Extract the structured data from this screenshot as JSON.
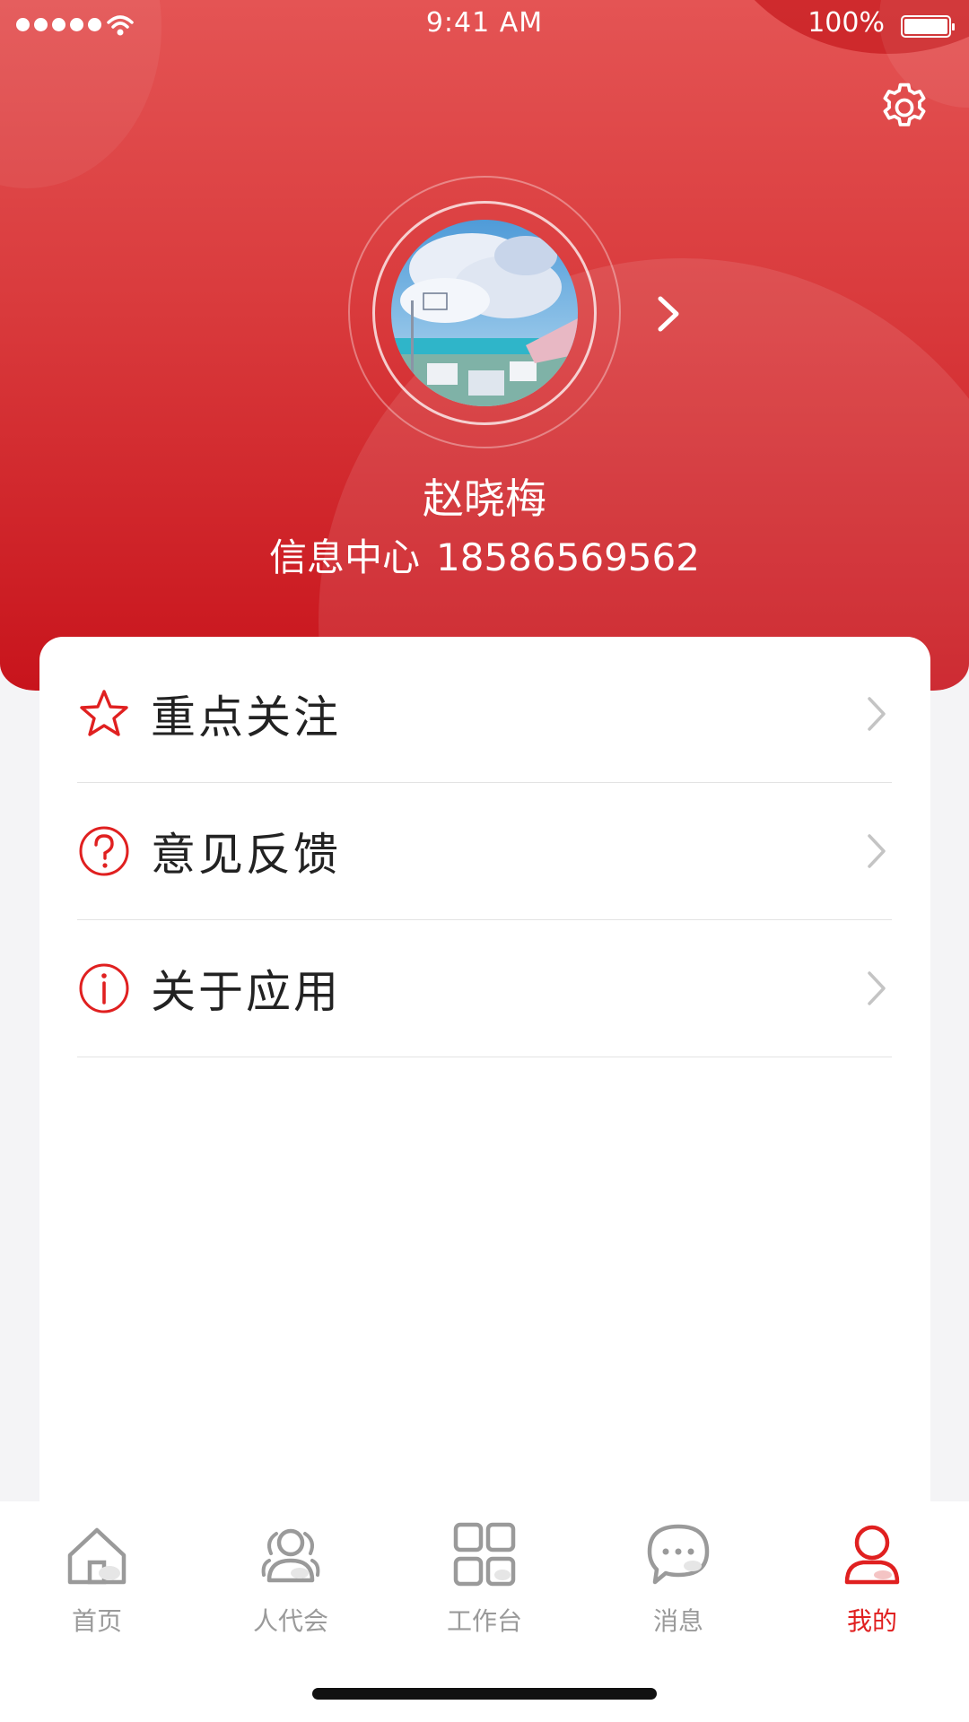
{
  "status_bar": {
    "time": "9:41 AM",
    "battery": "100%"
  },
  "profile": {
    "name": "赵晓梅",
    "department": "信息中心",
    "phone": "18586569562"
  },
  "menu": [
    {
      "label": "重点关注",
      "icon": "star-icon"
    },
    {
      "label": "意见反馈",
      "icon": "question-icon"
    },
    {
      "label": "关于应用",
      "icon": "info-icon"
    }
  ],
  "tabs": [
    {
      "label": "首页",
      "icon": "home-icon",
      "active": false
    },
    {
      "label": "人代会",
      "icon": "people-icon",
      "active": false
    },
    {
      "label": "工作台",
      "icon": "grid-icon",
      "active": false
    },
    {
      "label": "消息",
      "icon": "chat-icon",
      "active": false
    },
    {
      "label": "我的",
      "icon": "user-icon",
      "active": true
    }
  ],
  "colors": {
    "brand_red": "#d8262a",
    "active_tab": "#e02020",
    "inactive_tab": "#9a9a9a"
  }
}
